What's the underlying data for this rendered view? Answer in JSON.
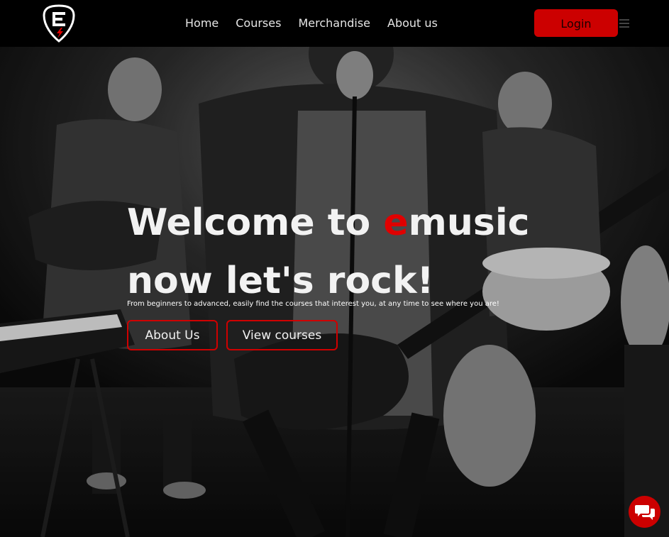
{
  "nav": {
    "logo_icon": "guitar-pick-e-icon",
    "links": [
      "Home",
      "Courses",
      "Merchandise",
      "About us"
    ],
    "login_label": "Login",
    "menu_icon": "hamburger-icon"
  },
  "hero": {
    "title_part1": "Welcome to ",
    "title_accent": "e",
    "title_part2": "music",
    "title_line2": "now let's rock!",
    "subtitle": "From beginners to advanced, easily find the courses that interest you, at any time to see where you are!",
    "about_button": "About Us",
    "courses_button": "View courses",
    "background_image": "band-performing-grayscale-photo"
  },
  "chat": {
    "icon": "chat-bubbles-icon"
  },
  "colors": {
    "accent": "#cc0000",
    "nav_bg": "#000000",
    "text": "#f2f2f2"
  }
}
